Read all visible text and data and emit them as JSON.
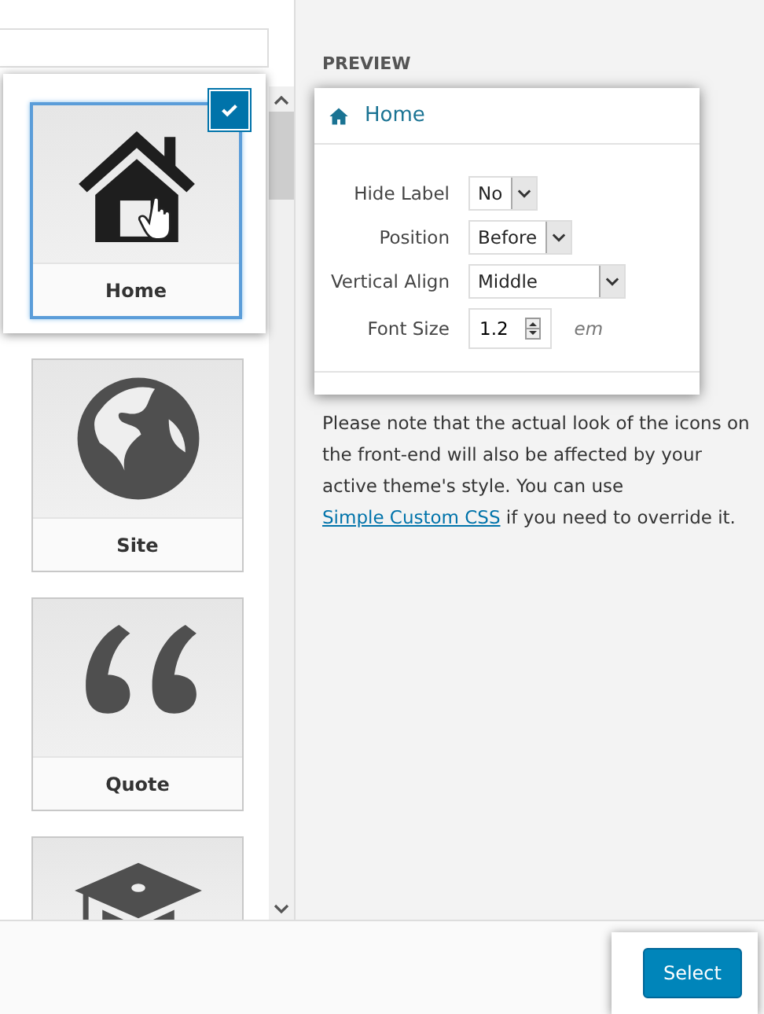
{
  "icons": [
    {
      "kind": "home",
      "label": "Home",
      "selected": true
    },
    {
      "kind": "globe",
      "label": "Site",
      "selected": false
    },
    {
      "kind": "quote",
      "label": "Quote",
      "selected": false
    },
    {
      "kind": "graduation",
      "selected": false
    }
  ],
  "preview": {
    "heading": "PREVIEW",
    "sample": "Home",
    "fields": [
      {
        "kind": "select",
        "label": "Hide Label",
        "value": "No"
      },
      {
        "kind": "select",
        "label": "Position",
        "value": "Before"
      },
      {
        "kind": "select",
        "label": "Vertical Align",
        "value": "Middle"
      },
      {
        "kind": "number",
        "label": "Font Size",
        "value": "1.2",
        "unit": "em"
      }
    ]
  },
  "note": {
    "before": "Please note that the actual look of the icons on the front-end will also be affected by your active theme's style. You can use",
    "link": "Simple Custom CSS",
    "after": "if you need to override it."
  },
  "footer": {
    "button": "Select"
  }
}
